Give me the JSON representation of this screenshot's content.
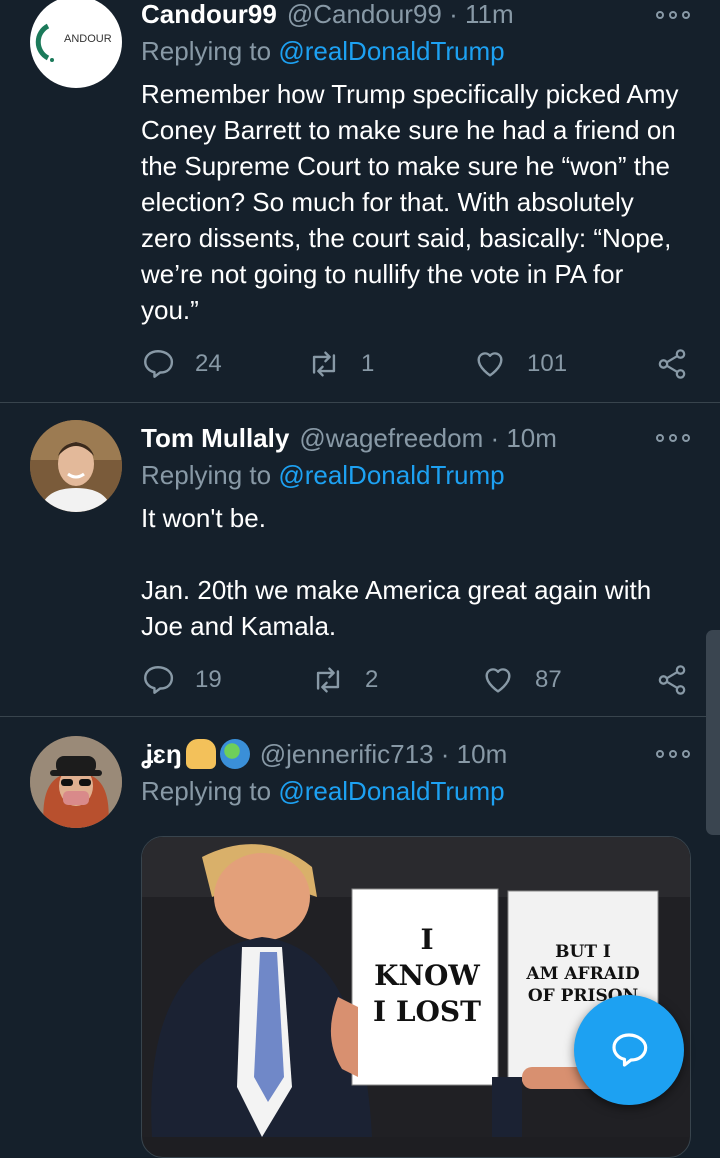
{
  "colors": {
    "background": "#15202b",
    "secondary_text": "#8899a6",
    "accent": "#1da1f2",
    "divider": "#38444d"
  },
  "tweets": [
    {
      "name": "Candour99",
      "handle": "@Candour99 · 11m",
      "replying_prefix": "Replying to ",
      "replying_to": "@realDonaldTrump",
      "avatar_text": "ANDOUR",
      "body": "Remember how Trump specifically picked Amy Coney Barrett to make sure he had a friend on the Supreme Court to make sure he “won” the election?  So much for that. With absolutely zero dissents, the court said, basically: “Nope, we’re not going to nullify the vote in PA for you.”",
      "replies": "24",
      "retweets": "1",
      "likes": "101"
    },
    {
      "name": "Tom Mullaly",
      "handle": "@wagefreedom · 10m",
      "replying_prefix": "Replying to ",
      "replying_to": "@realDonaldTrump",
      "body": "It won't be.\n\nJan. 20th we make America great again with Joe and Kamala.",
      "replies": "19",
      "retweets": "2",
      "likes": "87"
    },
    {
      "name": "ʝɛŋ",
      "emoji": [
        "folded-hands-emoji",
        "globe-emoji"
      ],
      "handle": "@jennerific713 · 10m",
      "replying_prefix": "Replying to ",
      "replying_to": "@realDonaldTrump",
      "media": {
        "left_sign": "I\nKNOW\nI LOST",
        "right_sign": "BUT I\nAM AFRAID\nOF PRISON"
      }
    }
  ],
  "icons": {
    "reply": "reply-icon",
    "retweet": "retweet-icon",
    "like": "heart-icon",
    "share": "share-icon",
    "more": "more-options-icon",
    "compose": "compose-reply-icon"
  }
}
